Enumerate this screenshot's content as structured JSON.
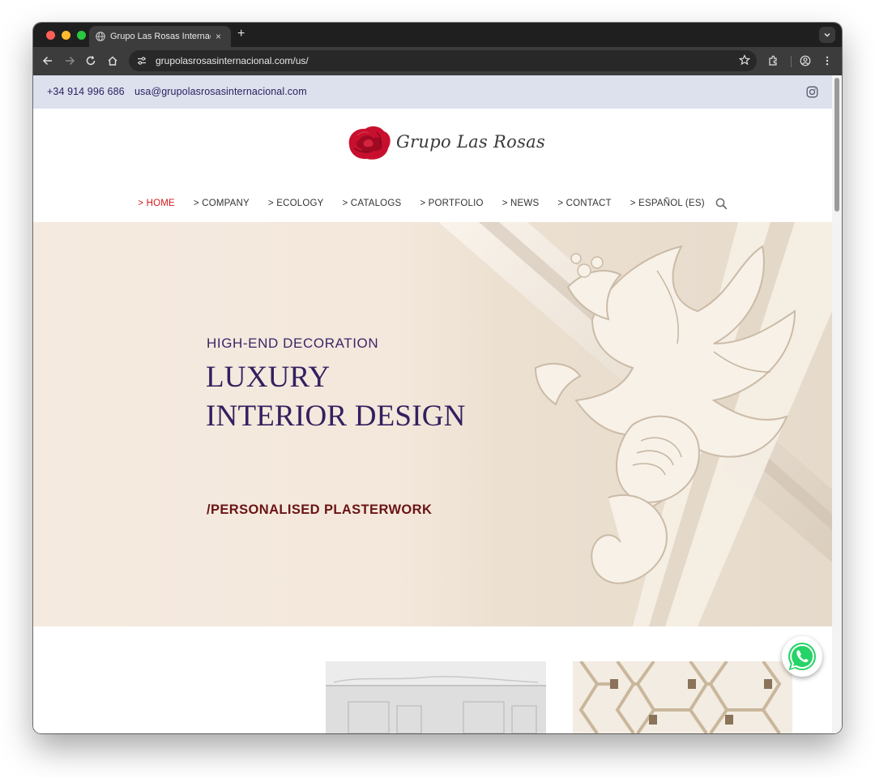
{
  "browser": {
    "tab_title": "Grupo Las Rosas Internacional",
    "tab_close": "×",
    "new_tab": "+",
    "url": "grupolasrosasinternacional.com/us/"
  },
  "topbar": {
    "phone": "+34 914 996 686",
    "email": "usa@grupolasrosasinternacional.com"
  },
  "logo": {
    "text": "Grupo Las Rosas"
  },
  "nav": {
    "items": [
      {
        "label": "> HOME",
        "active": true
      },
      {
        "label": "> COMPANY"
      },
      {
        "label": "> ECOLOGY"
      },
      {
        "label": "> CATALOGS"
      },
      {
        "label": "> PORTFOLIO"
      },
      {
        "label": "> NEWS"
      },
      {
        "label": "> CONTACT"
      },
      {
        "label": "> ESPAÑOL (ES)"
      }
    ]
  },
  "hero": {
    "kicker": "HIGH-END DECORATION",
    "title_line1": "LUXURY",
    "title_line2": "INTERIOR DESIGN",
    "subtitle": "/PERSONALISED PLASTERWORK"
  },
  "colors": {
    "accent_red": "#d21a1a",
    "brand_purple": "#33205f",
    "topbar_bg": "#dde1ee",
    "hero_bg": "#f5eadf",
    "subtitle_maroon": "#6a1414",
    "whatsapp_green": "#25d366"
  },
  "icons": [
    "globe-icon",
    "back-icon",
    "forward-icon",
    "reload-icon",
    "home-icon",
    "site-info-icon",
    "star-icon",
    "extensions-icon",
    "profile-icon",
    "kebab-menu-icon",
    "instagram-icon",
    "rose-logo-icon",
    "search-icon",
    "whatsapp-icon",
    "chevron-down-icon"
  ]
}
